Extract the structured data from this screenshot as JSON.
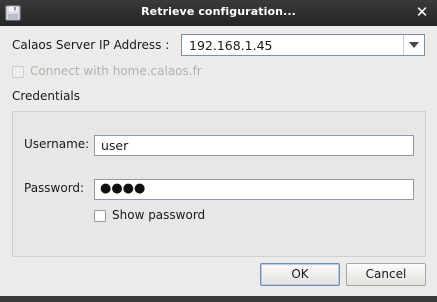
{
  "window": {
    "title": "Retrieve configuration...",
    "app_icon": "floppy-disk-icon",
    "close_icon": "close-icon"
  },
  "server": {
    "label": "Calaos Server IP Address :",
    "selected_value": "192.168.1.45",
    "dropdown_icon": "chevron-down-icon"
  },
  "connect_home": {
    "label": "Connect with home.calaos.fr",
    "checked": false,
    "enabled": false
  },
  "credentials": {
    "section_label": "Credentials",
    "username_label": "Username:",
    "username_value": "user",
    "password_label": "Password:",
    "password_masked": "●●●●",
    "show_password_label": "Show password",
    "show_password_checked": false
  },
  "buttons": {
    "ok_label": "OK",
    "cancel_label": "Cancel"
  },
  "colors": {
    "title_bar": "#2e2e2e",
    "dialog_bg": "#edebe9",
    "default_button_border": "#6f8cb6"
  }
}
